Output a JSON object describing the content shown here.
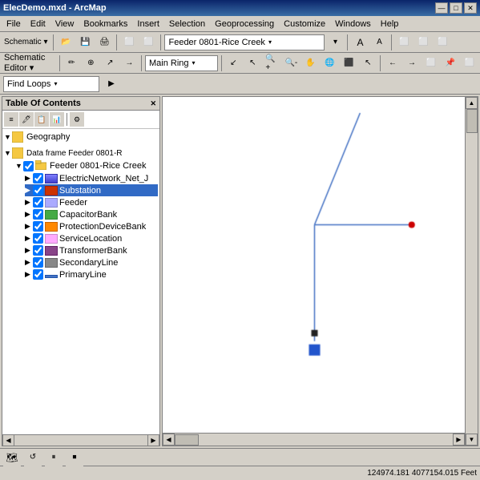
{
  "titleBar": {
    "title": "ElecDemo.mxd - ArcMap",
    "minimize": "—",
    "maximize": "□",
    "close": "✕"
  },
  "menuBar": {
    "items": [
      "File",
      "Edit",
      "View",
      "Bookmarks",
      "Insert",
      "Selection",
      "Geoprocessing",
      "Customize",
      "Windows",
      "Help"
    ]
  },
  "toolbar1": {
    "schematicLabel": "Schematic ▾",
    "feederDropdown": "Feeder 0801-Rice Creek",
    "dropdownArrow": "▾"
  },
  "toolbar2": {
    "schematicEditorLabel": "Schematic Editor ▾",
    "mainRingDropdown": "Main Ring",
    "dropdownArrow": "▾"
  },
  "findLoopsBar": {
    "label": "Find Loops",
    "dropdownArrow": "▾"
  },
  "toc": {
    "header": "Table Of Contents",
    "closeBtn": "✕",
    "items": [
      {
        "id": "geography",
        "label": "Geography",
        "level": 0,
        "expanded": true,
        "hasCheck": false,
        "iconType": "geo"
      },
      {
        "id": "dataframe",
        "label": "Data frame Feeder 0801-R",
        "level": 0,
        "expanded": true,
        "hasCheck": false,
        "iconType": "df"
      },
      {
        "id": "feeder0801",
        "label": "Feeder 0801-Rice Creek",
        "level": 1,
        "expanded": true,
        "hasCheck": true,
        "checked": true,
        "iconType": "folder"
      },
      {
        "id": "electricnetwork",
        "label": "ElectricNetwork_Net_J",
        "level": 2,
        "expanded": false,
        "hasCheck": true,
        "checked": true,
        "iconType": "layer"
      },
      {
        "id": "substation",
        "label": "Substation",
        "level": 2,
        "expanded": false,
        "hasCheck": true,
        "checked": true,
        "iconType": "layer",
        "selected": true
      },
      {
        "id": "feeder",
        "label": "Feeder",
        "level": 2,
        "expanded": false,
        "hasCheck": true,
        "checked": true,
        "iconType": "layer"
      },
      {
        "id": "capacitorbank",
        "label": "CapacitorBank",
        "level": 2,
        "expanded": false,
        "hasCheck": true,
        "checked": true,
        "iconType": "layer"
      },
      {
        "id": "protectiondevice",
        "label": "ProtectionDeviceBank",
        "level": 2,
        "expanded": false,
        "hasCheck": true,
        "checked": true,
        "iconType": "layer"
      },
      {
        "id": "servicelocation",
        "label": "ServiceLocation",
        "level": 2,
        "expanded": false,
        "hasCheck": true,
        "checked": true,
        "iconType": "layer"
      },
      {
        "id": "transformerbank",
        "label": "TransformerBank",
        "level": 2,
        "expanded": false,
        "hasCheck": true,
        "checked": true,
        "iconType": "layer"
      },
      {
        "id": "secondaryline",
        "label": "SecondaryLine",
        "level": 2,
        "expanded": false,
        "hasCheck": true,
        "checked": true,
        "iconType": "layer"
      },
      {
        "id": "primaryline",
        "label": "PrimaryLine",
        "level": 2,
        "expanded": false,
        "hasCheck": true,
        "checked": true,
        "iconType": "layer"
      }
    ]
  },
  "statusBar": {
    "coords": "124974.181  4077154.015 Feet"
  },
  "map": {
    "bgColor": "#ffffff",
    "lineColor": "#4472c4",
    "dotColor": "#cc0000",
    "squareSmallColor": "#222222",
    "squareLargeColor": "#2255cc"
  }
}
